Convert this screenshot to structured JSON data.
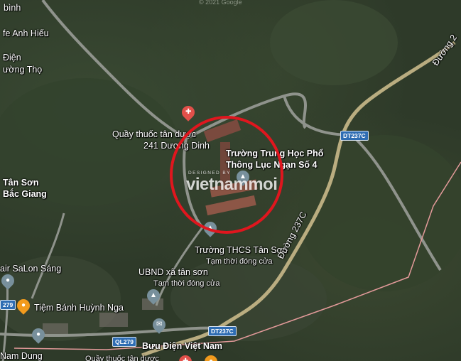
{
  "map": {
    "copyright": "© 2021 Google",
    "labels": {
      "binh": "bình",
      "cafe_anh_hieu": "fe Anh Hiếu",
      "dien": "Điện",
      "duong_tho": "ường Thọ",
      "tan_son": "Tân Sơn",
      "bac_giang": "Bắc Giang",
      "quay_thuoc_1": "Quầy thuốc tân dược",
      "quay_thuoc_2": "241 Dương Dinh",
      "truong_thpt_1": "Trường Trung Học Phổ",
      "truong_thpt_2": "Thông Lục Ngạn Số 4",
      "truong_thcs": "Trường THCS Tân Sơn",
      "truong_thcs_status": "Tạm thời đóng cửa",
      "ubnd": "UBND xã tân sơn",
      "ubnd_status": "Tạm thời đóng cửa",
      "salon": "air SaLon Sáng",
      "tiem_banh": "Tiệm Bánh Huỳnh Nga",
      "buu_dien": "Bưu Điện Việt Nam",
      "nam_dung": "Nam Dung",
      "duong_237c": "Đường 237C",
      "duong_2": "Đường 2",
      "quay_thuoc_bottom": "Quầy thuốc tân dược"
    },
    "shields": {
      "dt237c_top": "DT237C",
      "dt237c_bottom": "DT237C",
      "ql279_left": "279",
      "ql279": "QL279"
    },
    "watermark": {
      "small": "DESIGNED BY",
      "big": "vietnammoi"
    },
    "highlight_color": "#e0161e",
    "icons": {
      "pharmacy": "pharmacy-pin-icon",
      "school": "school-pin-icon",
      "government": "government-pin-icon",
      "bakery": "bakery-pin-icon",
      "post": "post-office-pin-icon",
      "place": "place-pin-icon"
    }
  }
}
